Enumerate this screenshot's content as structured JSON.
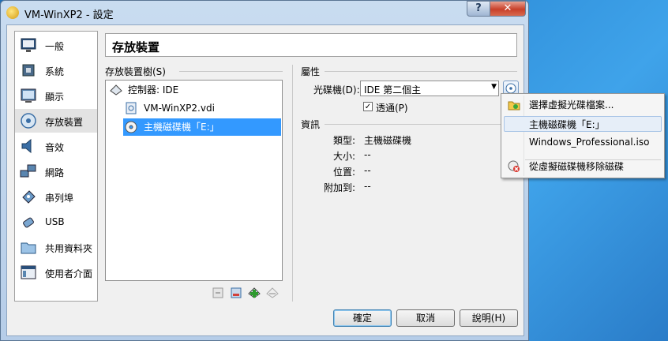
{
  "window": {
    "title": "VM-WinXP2 - 設定",
    "help_label": "?",
    "close_label": "✕"
  },
  "sidebar": {
    "items": [
      {
        "label": "一般",
        "icon": "monitor-icon"
      },
      {
        "label": "系統",
        "icon": "chip-icon"
      },
      {
        "label": "顯示",
        "icon": "display-icon"
      },
      {
        "label": "存放裝置",
        "icon": "storage-icon",
        "selected": true
      },
      {
        "label": "音效",
        "icon": "speaker-icon"
      },
      {
        "label": "網路",
        "icon": "network-icon"
      },
      {
        "label": "串列埠",
        "icon": "serial-port-icon"
      },
      {
        "label": "USB",
        "icon": "usb-icon"
      },
      {
        "label": "共用資料夾",
        "icon": "folder-icon"
      },
      {
        "label": "使用者介面",
        "icon": "ui-icon"
      }
    ]
  },
  "page": {
    "title": "存放裝置"
  },
  "tree": {
    "header": "存放裝置樹(S)",
    "controller": "控制器: IDE",
    "items": [
      {
        "label": "VM-WinXP2.vdi",
        "icon": "hard-disk-icon"
      },
      {
        "label": "主機磁碟機「E:」",
        "icon": "optical-disc-icon",
        "selected": true
      }
    ],
    "toolbar": [
      "remove-attachment-icon",
      "add-hard-disk-icon",
      "add-controller-icon",
      "remove-controller-icon"
    ]
  },
  "attributes": {
    "header": "屬性",
    "optical_drive_label": "光碟機(D):",
    "optical_drive_value": "IDE 第二個主",
    "passthrough_label": "透通(P)",
    "passthrough_checked": true
  },
  "info": {
    "header": "資訊",
    "rows": [
      {
        "label": "類型:",
        "value": "主機磁碟機"
      },
      {
        "label": "大小:",
        "value": "--"
      },
      {
        "label": "位置:",
        "value": "--"
      },
      {
        "label": "附加到:",
        "value": "--"
      }
    ]
  },
  "buttons": {
    "ok": "確定",
    "cancel": "取消",
    "help": "說明(H)"
  },
  "disc_menu": {
    "items": [
      {
        "label": "選擇虛擬光碟檔案...",
        "icon": "choose-disc-icon"
      },
      {
        "label": "主機磁碟機「E:」",
        "hover": true
      },
      {
        "label": "Windows_Professional.iso"
      },
      {
        "label": "從虛擬磁碟機移除磁碟",
        "icon": "remove-disc-icon"
      }
    ]
  }
}
